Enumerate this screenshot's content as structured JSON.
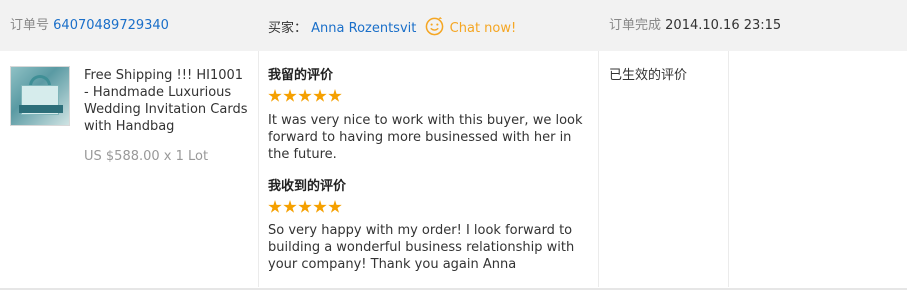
{
  "header": {
    "order_no_label": "订单号",
    "order_no": "64070489729340",
    "buyer_label": "买家：",
    "buyer_name": "Anna Rozentsvit",
    "chat_label": "Chat now!",
    "status_label": "订单完成",
    "completed_time": "2014.10.16 23:15"
  },
  "product": {
    "title": "Free Shipping !!! HI1001 - Handmade Luxurious Wedding Invitation Cards with Handbag",
    "price": "US $588.00 x 1 Lot",
    "thumbnail_icon": "product-photo"
  },
  "feedback": {
    "given_title": "我留的评价",
    "given_rating": 5,
    "given_comment": "It was very nice to work with this buyer, we look forward to having more businessed with her in the future.",
    "received_title": "我收到的评价",
    "received_rating": 5,
    "received_comment": "So very happy with my order! I look forward to building a wonderful business relationship with your company! Thank you again Anna",
    "star_color": "#f5a000"
  },
  "status": {
    "text": "已生效的评价"
  },
  "colors": {
    "link": "#1a6fc9",
    "chat": "#f5a623",
    "header_bg": "#f2f2f2"
  }
}
